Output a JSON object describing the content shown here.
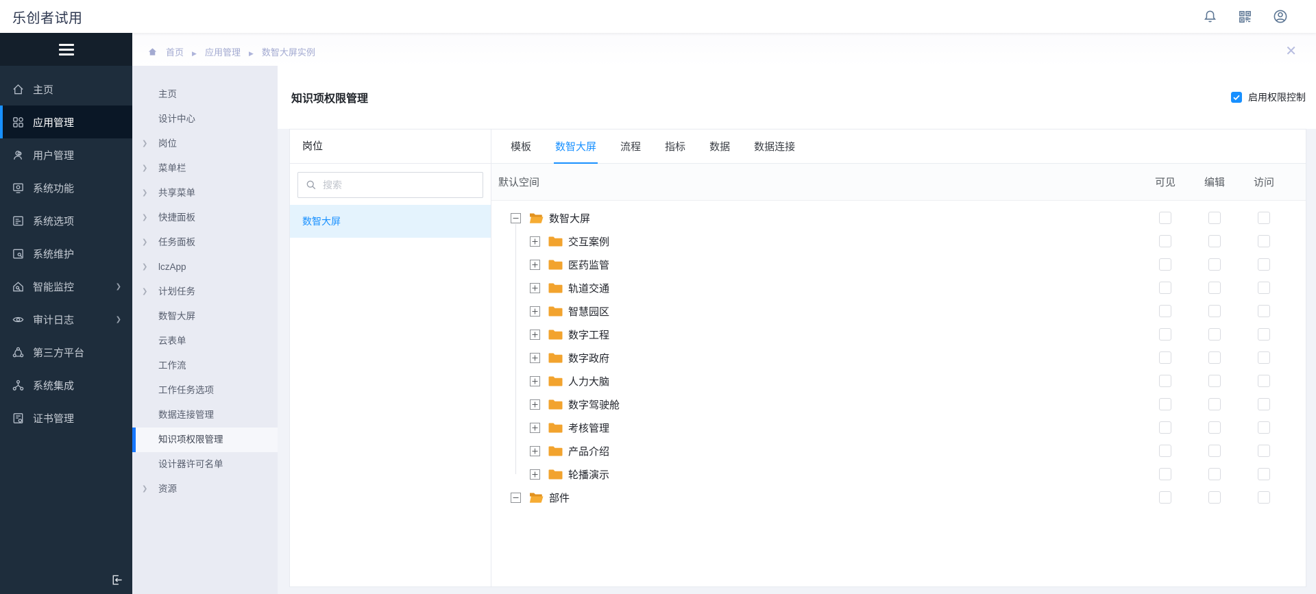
{
  "colors": {
    "accent": "#1890ff",
    "folder": "#f2a32e",
    "sidebar_bg": "#1e2d3c",
    "submenu_bg": "#e9ebf3"
  },
  "header": {
    "app_title": "乐创者试用",
    "icons": [
      "bell",
      "qr-code",
      "user-avatar"
    ]
  },
  "breadcrumb": {
    "items": [
      {
        "label": "首页"
      },
      {
        "label": "应用管理"
      },
      {
        "label": "数智大屏实例"
      }
    ],
    "close": "✕"
  },
  "sidebar": {
    "items": [
      {
        "label": "主页",
        "icon": "#i-home",
        "selected": false,
        "arrow": false
      },
      {
        "label": "应用管理",
        "icon": "#i-apps",
        "selected": true,
        "arrow": false
      },
      {
        "label": "用户管理",
        "icon": "#i-users",
        "selected": false,
        "arrow": false
      },
      {
        "label": "系统功能",
        "icon": "#i-monitor",
        "selected": false,
        "arrow": false
      },
      {
        "label": "系统选项",
        "icon": "#i-options",
        "selected": false,
        "arrow": false
      },
      {
        "label": "系统维护",
        "icon": "#i-maintain",
        "selected": false,
        "arrow": false
      },
      {
        "label": "智能监控",
        "icon": "#i-smart",
        "selected": false,
        "arrow": true
      },
      {
        "label": "审计日志",
        "icon": "#i-eye",
        "selected": false,
        "arrow": true
      },
      {
        "label": "第三方平台",
        "icon": "#i-third",
        "selected": false,
        "arrow": false
      },
      {
        "label": "系统集成",
        "icon": "#i-integrate",
        "selected": false,
        "arrow": false
      },
      {
        "label": "证书管理",
        "icon": "#i-cert",
        "selected": false,
        "arrow": false
      }
    ]
  },
  "submenu": {
    "items": [
      {
        "label": "主页",
        "arrow": false,
        "selected": false
      },
      {
        "label": "设计中心",
        "arrow": false,
        "selected": false
      },
      {
        "label": "岗位",
        "arrow": true,
        "selected": false
      },
      {
        "label": "菜单栏",
        "arrow": true,
        "selected": false
      },
      {
        "label": "共享菜单",
        "arrow": true,
        "selected": false
      },
      {
        "label": "快捷面板",
        "arrow": true,
        "selected": false
      },
      {
        "label": "任务面板",
        "arrow": true,
        "selected": false
      },
      {
        "label": "lczApp",
        "arrow": true,
        "selected": false
      },
      {
        "label": "计划任务",
        "arrow": true,
        "selected": false
      },
      {
        "label": "数智大屏",
        "arrow": false,
        "selected": false
      },
      {
        "label": "云表单",
        "arrow": false,
        "selected": false
      },
      {
        "label": "工作流",
        "arrow": false,
        "selected": false
      },
      {
        "label": "工作任务选项",
        "arrow": false,
        "selected": false
      },
      {
        "label": "数据连接管理",
        "arrow": false,
        "selected": false
      },
      {
        "label": "知识项权限管理",
        "arrow": false,
        "selected": true
      },
      {
        "label": "设计器许可名单",
        "arrow": false,
        "selected": false
      },
      {
        "label": "资源",
        "arrow": true,
        "selected": false
      }
    ]
  },
  "main": {
    "title": "知识项权限管理",
    "permission_toggle": {
      "label": "启用权限控制",
      "checked": true
    },
    "positions_panel": {
      "title": "岗位",
      "search_placeholder": "搜索",
      "items": [
        {
          "label": "数智大屏",
          "selected": true
        }
      ]
    },
    "tabs": [
      {
        "label": "模板",
        "active": false
      },
      {
        "label": "数智大屏",
        "active": true
      },
      {
        "label": "流程",
        "active": false
      },
      {
        "label": "指标",
        "active": false
      },
      {
        "label": "数据",
        "active": false
      },
      {
        "label": "数据连接",
        "active": false
      }
    ],
    "table": {
      "space_label": "默认空间",
      "columns": [
        "可见",
        "编辑",
        "访问"
      ],
      "tree": [
        {
          "label": "数智大屏",
          "expanded": true,
          "children": [
            "交互案例",
            "医药监管",
            "轨道交通",
            "智慧园区",
            "数字工程",
            "数字政府",
            "人力大脑",
            "数字驾驶舱",
            "考核管理",
            "产品介绍",
            "轮播演示"
          ]
        },
        {
          "label": "部件",
          "expanded": true,
          "children": []
        }
      ]
    }
  }
}
